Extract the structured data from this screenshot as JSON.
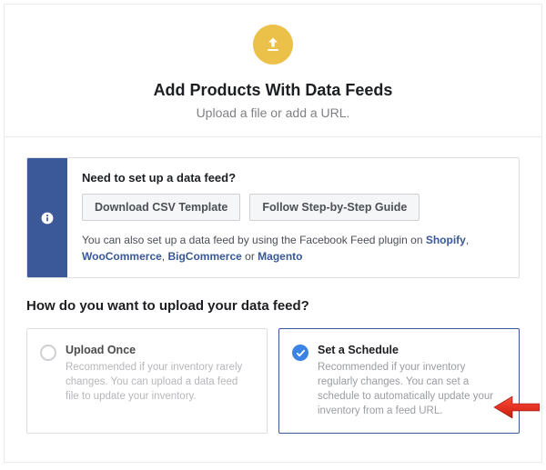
{
  "header": {
    "title": "Add Products With Data Feeds",
    "subtitle": "Upload a file or add a URL."
  },
  "tip": {
    "title": "Need to set up a data feed?",
    "button_csv": "Download CSV Template",
    "button_guide": "Follow Step-by-Step Guide",
    "help_prefix": "You can also set up a data feed by using the Facebook Feed plugin on ",
    "link_shopify": "Shopify",
    "sep1": ", ",
    "link_woo": "WooCommerce",
    "sep2": ", ",
    "link_big": "BigCommerce",
    "sep3": " or ",
    "link_magento": "Magento"
  },
  "question": "How do you want to upload your data feed?",
  "options": {
    "once": {
      "title": "Upload Once",
      "desc": "Recommended if your inventory rarely changes. You can upload a data feed file to update your inventory."
    },
    "schedule": {
      "title": "Set a Schedule",
      "desc": "Recommended if your inventory regularly changes. You can set a schedule to automatically update your inventory from a feed URL."
    }
  }
}
